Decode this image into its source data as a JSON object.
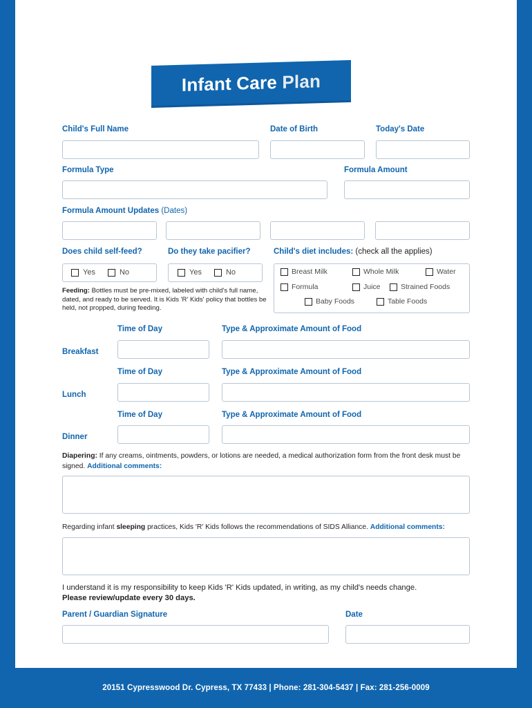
{
  "title": {
    "part1": "Infant Care ",
    "part2": "Plan"
  },
  "labels": {
    "child_name": "Child's Full Name",
    "dob": "Date of Birth",
    "today": "Today's Date",
    "formula_type": "Formula Type",
    "formula_amount": "Formula Amount",
    "formula_updates": "Formula Amount Updates ",
    "formula_updates_note": "(Dates)",
    "self_feed": "Does child self-feed?",
    "pacifier": "Do they take pacifier?",
    "diet_includes": "Child's diet includes: ",
    "diet_note": "(check all the applies)",
    "time_of_day": "Time of Day",
    "type_amount": "Type & Approximate Amount of Food",
    "breakfast": "Breakfast",
    "lunch": "Lunch",
    "dinner": "Dinner",
    "parent_signature": "Parent / Guardian Signature",
    "date": "Date"
  },
  "yesno": {
    "yes": "Yes",
    "no": "No"
  },
  "diet_options": [
    "Breast Milk",
    "Whole Milk",
    "Water",
    "Formula",
    "Juice",
    "Strained Foods",
    "Baby Foods",
    "Table Foods"
  ],
  "feeding_note": {
    "bold": "Feeding:",
    "text": " Bottles must be pre-mixed, labeled with child's full name, dated, and ready to be served. It is Kids 'R' Kids' policy that bottles be held, not propped, during feeding."
  },
  "diapering_note": {
    "bold": "Diapering:",
    "text": " If any creams, ointments, powders, or lotions are needed, a medical authorization form from the front desk must be signed. ",
    "blue": "Additional comments:"
  },
  "sleeping_note": {
    "pre": "Regarding infant ",
    "bold": "sleeping",
    "text": " practices, Kids 'R' Kids follows the recommendations of SIDS Alliance. ",
    "blue": "Additional comments:"
  },
  "statement": {
    "line1": "I understand it is my responsibility to keep Kids 'R' Kids updated, in writing, as my child's needs change.",
    "line2": "Please review/update every 30 days."
  },
  "footer": "20151 Cypresswood Dr. Cypress, TX 77433 | Phone: 281-304-5437 | Fax: 281-256-0009",
  "colors": {
    "accent": "#1065ae",
    "border": "#b9c6d3",
    "text": "#231f20"
  },
  "fields": {
    "child_name": "",
    "dob": "",
    "today": "",
    "formula_type": "",
    "formula_amount": "",
    "update1": "",
    "update2": "",
    "update3": "",
    "update4": "",
    "breakfast_time": "",
    "breakfast_food": "",
    "lunch_time": "",
    "lunch_food": "",
    "dinner_time": "",
    "dinner_food": "",
    "diapering_comments": "",
    "sleeping_comments": "",
    "signature": "",
    "signature_date": ""
  }
}
